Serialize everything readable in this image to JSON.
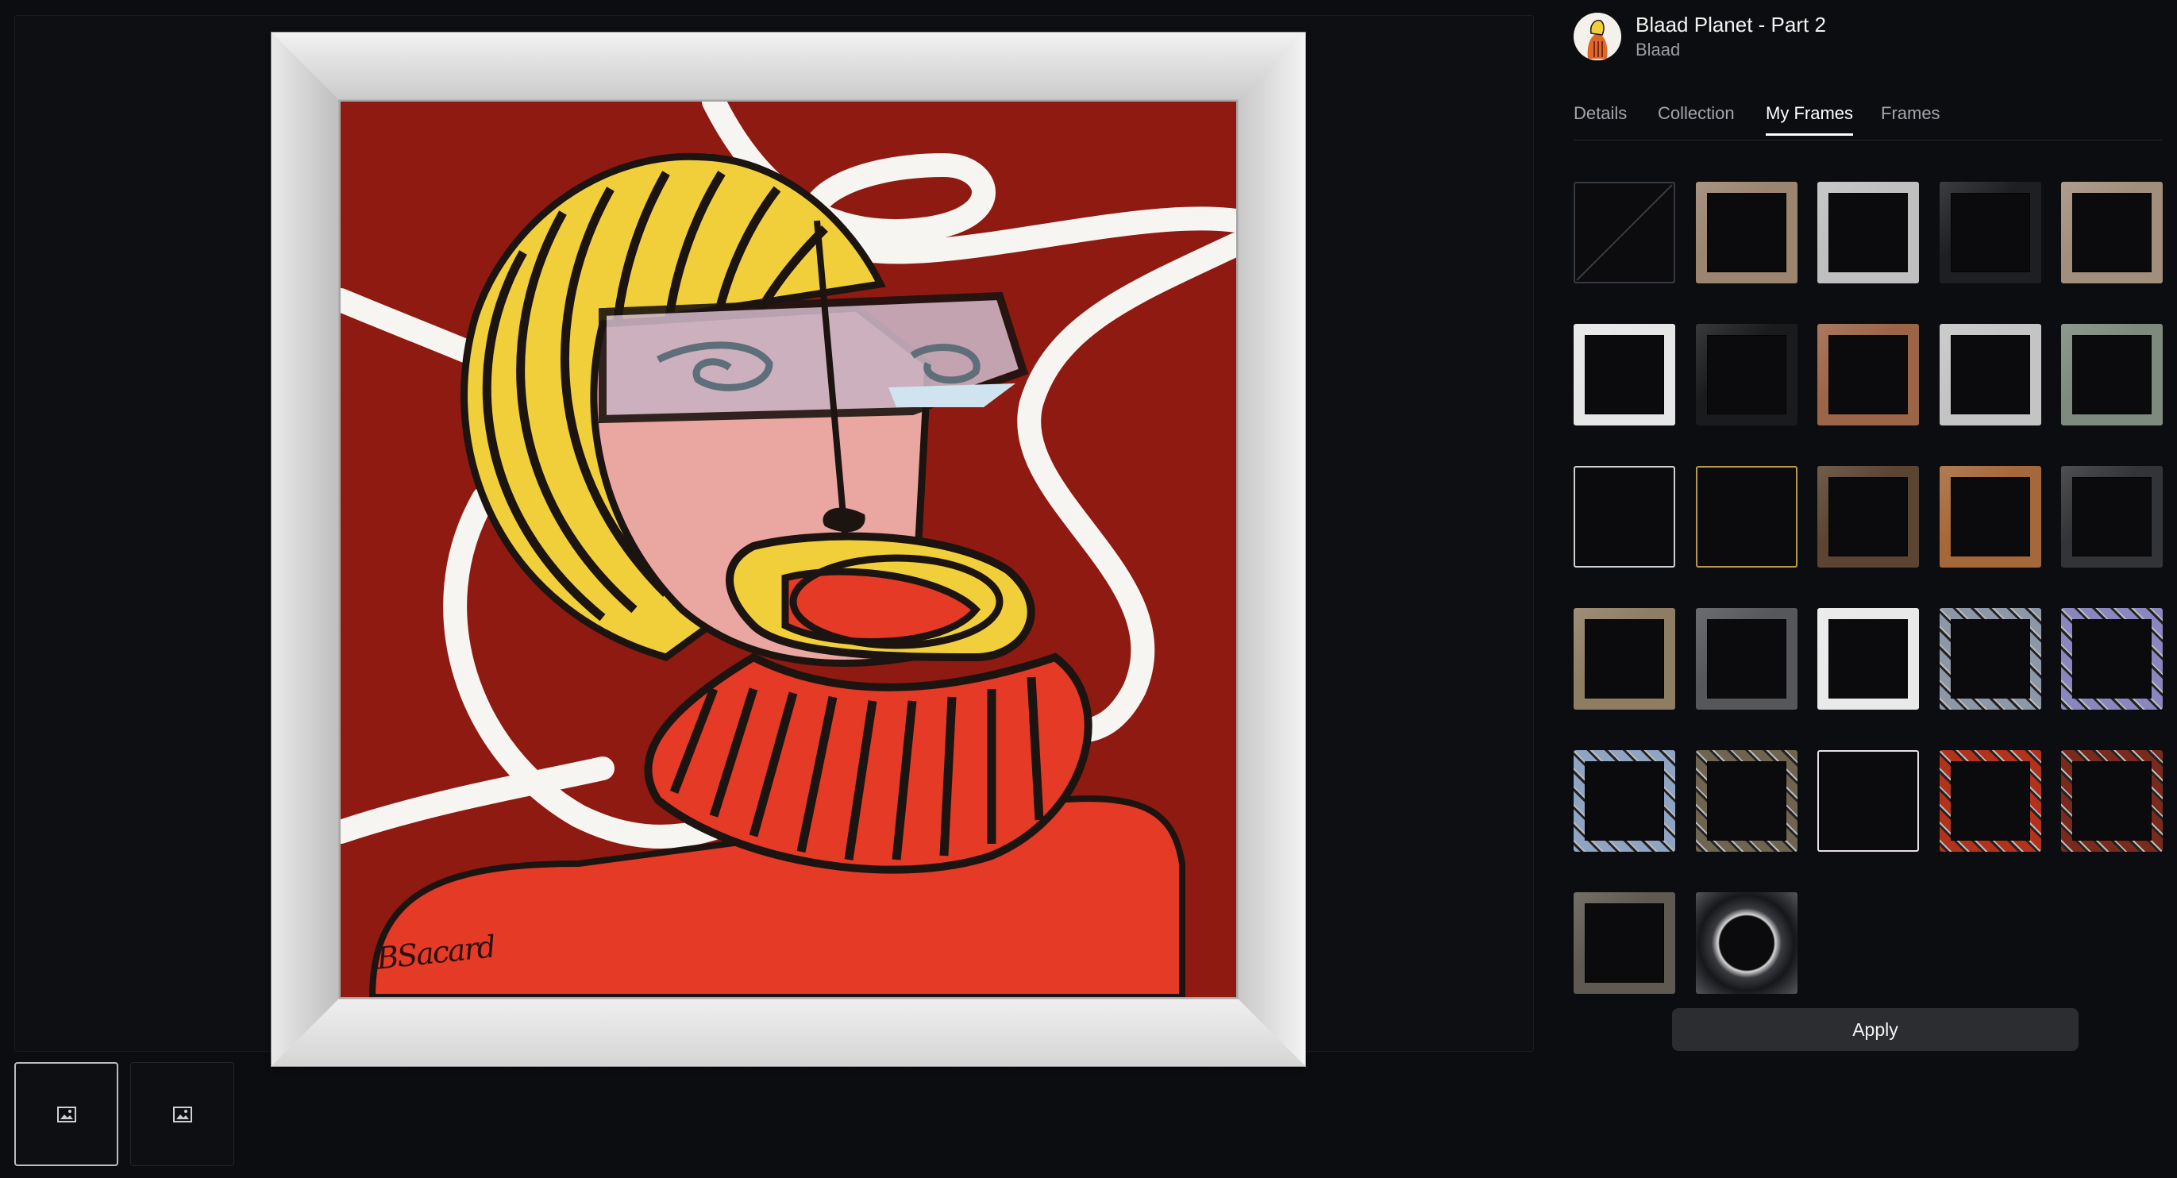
{
  "artwork": {
    "signature": "BSacard",
    "colors": {
      "background": "#8f1a12",
      "sweater": "#e43a26",
      "hair": "#f1cf3a",
      "skin": "#eaa6a0",
      "outline": "#1c1410",
      "swirl": "#f7f5f2",
      "frame_wood": "#d7d7d7"
    }
  },
  "thumbnails": [
    {
      "icon": "image-icon",
      "active": true
    },
    {
      "icon": "image-icon",
      "active": false
    }
  ],
  "header": {
    "title": "Blaad Planet - Part 2",
    "artist": "Blaad"
  },
  "tabs": [
    {
      "label": "Details",
      "active": false
    },
    {
      "label": "Collection",
      "active": false
    },
    {
      "label": "My Frames",
      "active": true
    },
    {
      "label": "Frames",
      "active": false
    }
  ],
  "frames": [
    {
      "style": "none",
      "edge": "#3a3b40",
      "fill": "#0c0c0e"
    },
    {
      "style": "solid",
      "edge": "#9b8470",
      "fill": "#0b0b0d"
    },
    {
      "style": "solid",
      "edge": "#bfbfbf",
      "fill": "#0b0b0d"
    },
    {
      "style": "solid",
      "edge": "#1e1f22",
      "fill": "#0b0b0d"
    },
    {
      "style": "solid",
      "edge": "#a28e7c",
      "fill": "#0b0b0d"
    },
    {
      "style": "solid",
      "edge": "#e6e6e6",
      "fill": "#0b0b0d"
    },
    {
      "style": "solid",
      "edge": "#1a1b1d",
      "fill": "#0b0b0d"
    },
    {
      "style": "solid",
      "edge": "#9c6548",
      "fill": "#0b0b0d"
    },
    {
      "style": "solid",
      "edge": "#c4c4c4",
      "fill": "#0b0b0d"
    },
    {
      "style": "solid",
      "edge": "#7d8a7d",
      "fill": "#0b0b0d"
    },
    {
      "style": "thin",
      "edge": "#cfcfcf",
      "fill": "#0b0b0d"
    },
    {
      "style": "thin",
      "edge": "#b89a4a",
      "fill": "#0b0b0d"
    },
    {
      "style": "solid",
      "edge": "#5b4432",
      "fill": "#0b0b0d"
    },
    {
      "style": "solid",
      "edge": "#a5683a",
      "fill": "#0b0b0d"
    },
    {
      "style": "solid",
      "edge": "#333437",
      "fill": "#0b0b0d"
    },
    {
      "style": "solid",
      "edge": "#8f7d63",
      "fill": "#0b0b0d"
    },
    {
      "style": "solid",
      "edge": "#55575a",
      "fill": "#0b0b0d"
    },
    {
      "style": "solid",
      "edge": "#e9e9ea",
      "fill": "#0b0b0d"
    },
    {
      "style": "ornate",
      "edge": "#8c98a6",
      "fill": "#0b0b0d"
    },
    {
      "style": "ornate",
      "edge": "#8a86c0",
      "fill": "#0b0b0d"
    },
    {
      "style": "ornate",
      "edge": "#8fa3c2",
      "fill": "#0b0b0d"
    },
    {
      "style": "ornate",
      "edge": "#6f6450",
      "fill": "#0b0b0d"
    },
    {
      "style": "thin",
      "edge": "#e8e2e6",
      "fill": "#0b0b0d"
    },
    {
      "style": "ornate",
      "edge": "#b2321c",
      "fill": "#0b0b0d"
    },
    {
      "style": "ornate",
      "edge": "#7a2a1c",
      "fill": "#0b0b0d"
    },
    {
      "style": "solid",
      "edge": "#5e5a51",
      "fill": "#0b0b0d"
    },
    {
      "style": "round",
      "edge": "#4d4f55",
      "fill": "#0b0b0d"
    }
  ],
  "apply_label": "Apply"
}
